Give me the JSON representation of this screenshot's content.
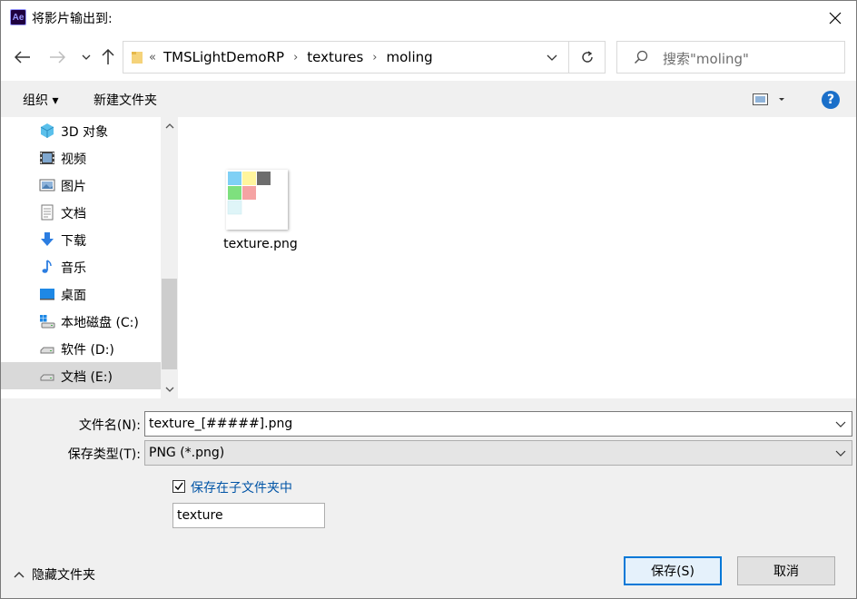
{
  "window": {
    "title": "将影片输出到:",
    "app_badge": "Ae"
  },
  "address": {
    "overflow": "«",
    "crumbs": [
      "TMSLightDemoRP",
      "textures",
      "moling"
    ]
  },
  "search": {
    "placeholder": "搜索\"moling\""
  },
  "toolbar": {
    "organize": "组织 ▾",
    "new_folder": "新建文件夹",
    "help": "?"
  },
  "sidebar": {
    "items": [
      {
        "label": "3D 对象",
        "icon": "cube-3d-icon"
      },
      {
        "label": "视频",
        "icon": "video-icon"
      },
      {
        "label": "图片",
        "icon": "pictures-icon"
      },
      {
        "label": "文档",
        "icon": "documents-icon"
      },
      {
        "label": "下载",
        "icon": "download-icon"
      },
      {
        "label": "音乐",
        "icon": "music-icon"
      },
      {
        "label": "桌面",
        "icon": "desktop-icon"
      },
      {
        "label": "本地磁盘 (C:)",
        "icon": "windows-drive-icon"
      },
      {
        "label": "软件 (D:)",
        "icon": "drive-icon"
      },
      {
        "label": "文档 (E:)",
        "icon": "drive-icon"
      }
    ],
    "selected_index": 9
  },
  "files": [
    {
      "name": "texture.png",
      "icon": "png-thumbnail-icon"
    }
  ],
  "form": {
    "filename_label": "文件名(N):",
    "filename_value": "texture_[#####].png",
    "type_label": "保存类型(T):",
    "type_value": "PNG (*.png)",
    "subfolder_check_label": "保存在子文件夹中",
    "subfolder_checked": true,
    "subfolder_value": "texture"
  },
  "footer": {
    "hide_folders": "隐藏文件夹",
    "save": "保存(S)",
    "cancel": "取消"
  },
  "colors": {
    "accent": "#0078d7",
    "link": "#0054a6",
    "selected": "#d9d9d9"
  }
}
